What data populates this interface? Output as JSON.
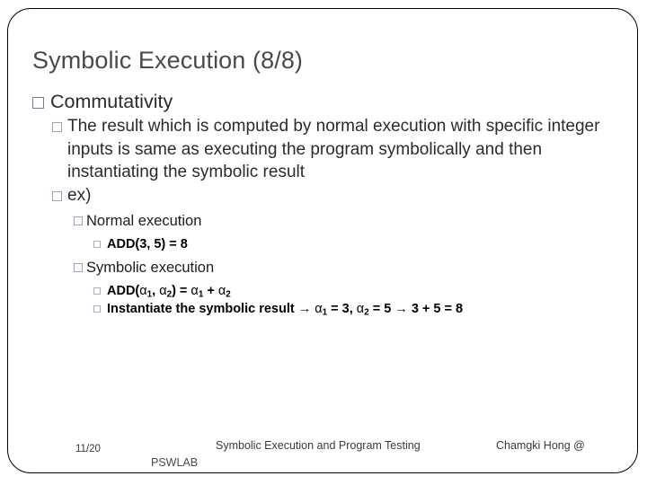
{
  "slide": {
    "title": "Symbolic Execution (8/8)",
    "frame_color": "#000000",
    "title_color": "#4a4a4a"
  },
  "bullets": {
    "level1": {
      "commutativity": "Commutativity"
    },
    "level2": {
      "definition": "The result which is computed by normal execution with specific integer inputs is same as executing the program symbolically and then instantiating the symbolic result",
      "example_label": "ex)"
    },
    "level3": {
      "normal_execution": "Normal execution",
      "symbolic_execution": "Symbolic execution"
    },
    "level4": {
      "normal_add": "ADD(3, 5) = 8",
      "symbolic_add_prefix": "ADD(",
      "symbolic_add_a1": "α",
      "symbolic_add_sub1": "1",
      "symbolic_add_mid": ", ",
      "symbolic_add_a2": "α",
      "symbolic_add_sub2": "2",
      "symbolic_add_eq": ") = ",
      "symbolic_add_a3": "α",
      "symbolic_add_sub3": "1",
      "symbolic_add_plus": " + ",
      "symbolic_add_a4": "α",
      "symbolic_add_sub4": "2",
      "instantiate_text": "Instantiate the symbolic result ",
      "instantiate_arrow1": "→",
      "instantiate_a1": "α",
      "instantiate_sub1": "1",
      "instantiate_val1": " = 3,  ",
      "instantiate_a2": "α",
      "instantiate_sub2": "2",
      "instantiate_val2": " = 5 ",
      "instantiate_arrow2": "→",
      "instantiate_result": " 3 + 5 = 8"
    }
  },
  "footer": {
    "page_number": "11/20",
    "lab": "PSWLAB",
    "center": "Symbolic Execution and Program Testing",
    "author": "Chamgki Hong  @"
  }
}
